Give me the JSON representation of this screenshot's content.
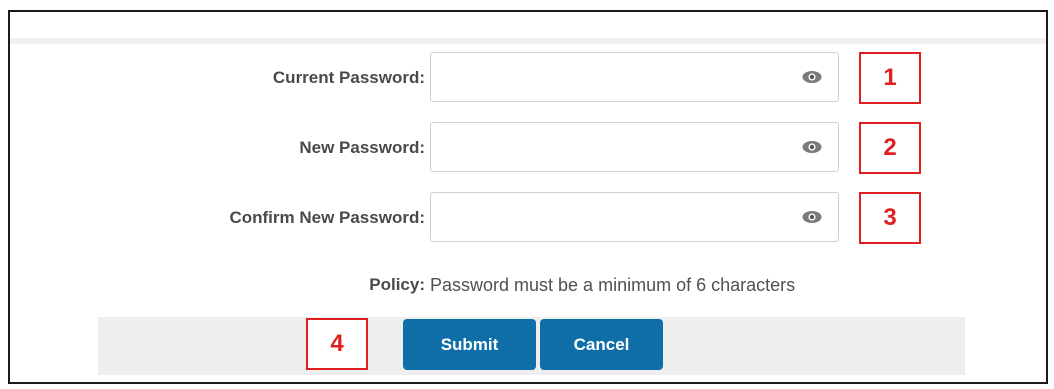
{
  "form": {
    "fields": [
      {
        "label": "Current Password:",
        "value": "",
        "placeholder": "",
        "marker": "1"
      },
      {
        "label": "New Password:",
        "value": "",
        "placeholder": "",
        "marker": "2"
      },
      {
        "label": "Confirm New Password:",
        "value": "",
        "placeholder": "",
        "marker": "3"
      }
    ],
    "policy": {
      "label": "Policy:",
      "text": "Password must be a minimum of 6 characters"
    }
  },
  "actions": {
    "submit_label": "Submit",
    "cancel_label": "Cancel",
    "marker": "4"
  },
  "icons": {
    "reveal_password": "eye-icon"
  },
  "colors": {
    "button": "#0f6ea8",
    "annotation": "#e02020",
    "footer_bg": "#eeeeee"
  }
}
